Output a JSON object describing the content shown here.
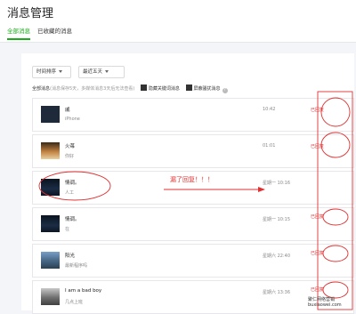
{
  "page": {
    "title": "消息管理"
  },
  "tabs": [
    {
      "label": "全部消息",
      "active": true
    },
    {
      "label": "已收藏的消息",
      "active": false
    }
  ],
  "filters": {
    "sort": "时间排序",
    "range": "最近五天"
  },
  "summary": {
    "title": "全部消息",
    "hint": "(消息保存5天，多媒体消息3天后无法查看)",
    "option1": "隐藏关键词消息",
    "option2": "屏蔽骚扰消息"
  },
  "messages": [
    {
      "name": "戚",
      "text": "iPhone",
      "time": "10:42",
      "reply": "已回复"
    },
    {
      "name": "火苺",
      "text": "你好",
      "time": "01:01",
      "reply": "已回复"
    },
    {
      "name": "情调。",
      "text": "人工",
      "time": "星期一 10:16",
      "reply": ""
    },
    {
      "name": "情调。",
      "text": "在",
      "time": "星期一 10:15",
      "reply": "已回复"
    },
    {
      "name": "阳光",
      "text": "最新程序吗",
      "time": "星期六 22:40",
      "reply": "已回复"
    },
    {
      "name": "I am a bad boy",
      "text": "几点上班",
      "time": "星期六 13:36",
      "reply": "已回复"
    }
  ],
  "annotation": {
    "text": "漏了回复！！！",
    "color": "#e03030"
  },
  "watermark": {
    "line1": "聚仁网络营销",
    "line2": "buxiaowei.com"
  }
}
